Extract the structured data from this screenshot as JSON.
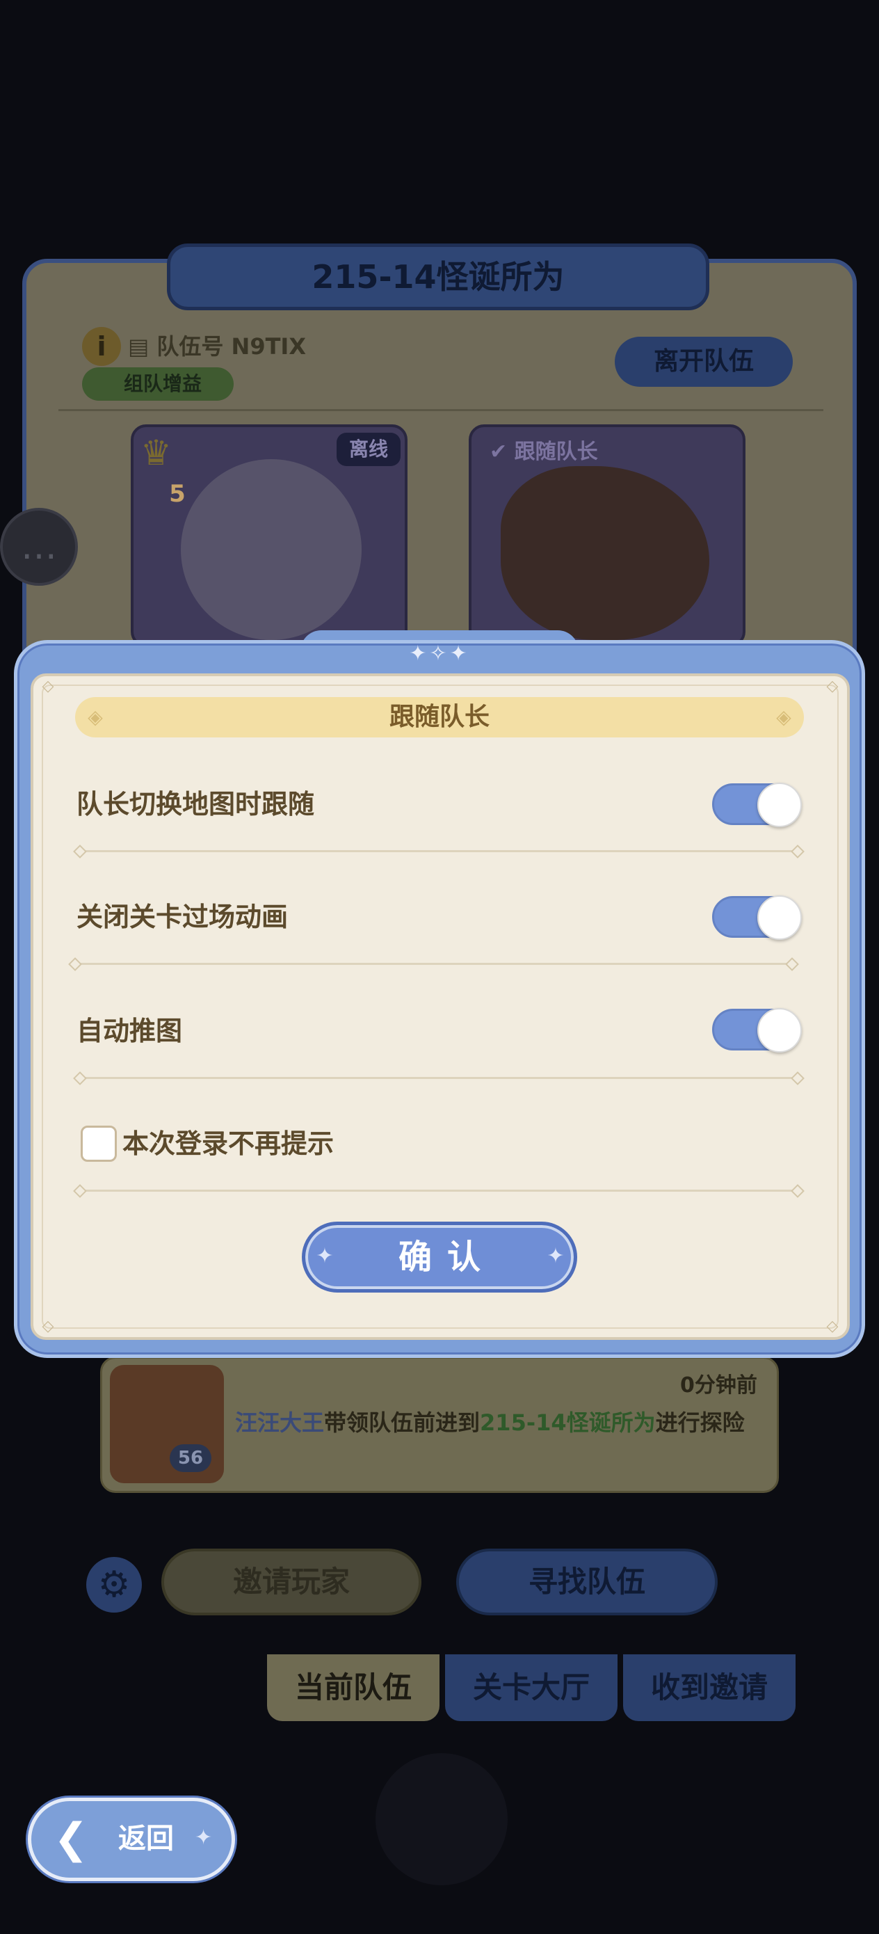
{
  "background": {
    "panel_title": "215-14怪诞所为",
    "team_number_label": "队伍号",
    "team_number_value": "N9TIX",
    "team_buff_label": "组队增益",
    "leave_team_label": "离开队伍",
    "member_1_status": "离线",
    "member_1_level": "5",
    "member_2_status": "跟随队长",
    "log": {
      "time": "0分钟前",
      "player_name": "汪汪大王",
      "text_before": "带领队伍前进到",
      "level_name": "215-14怪诞所为",
      "text_after": "进行探险",
      "avatar_level": "56"
    },
    "invite_players_label": "邀请玩家",
    "find_team_label": "寻找队伍",
    "tabs": [
      "当前队伍",
      "关卡大厅",
      "收到邀请"
    ]
  },
  "modal": {
    "title": "跟随队长",
    "options": [
      {
        "label": "队长切换地图时跟随",
        "enabled": true
      },
      {
        "label": "关闭关卡过场动画",
        "enabled": true
      },
      {
        "label": "自动推图",
        "enabled": true
      }
    ],
    "dont_remind_label": "本次登录不再提示",
    "dont_remind_checked": false,
    "confirm_label": "确认"
  },
  "back_label": "返回",
  "colors": {
    "modal_blue": "#7d9fd8",
    "panel_cream": "#f2ecdf",
    "header_gold": "#f3dfa5",
    "toggle_on": "#7393d7",
    "text_brown": "#5c4a2c"
  }
}
